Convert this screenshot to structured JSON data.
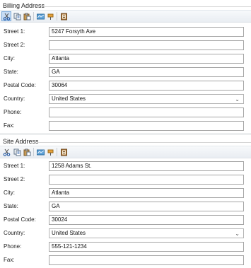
{
  "billing": {
    "title": "Billing Address",
    "fields": {
      "street1": {
        "label": "Street 1:",
        "value": "5247 Forsyth Ave"
      },
      "street2": {
        "label": "Street 2:",
        "value": ""
      },
      "city": {
        "label": "City:",
        "value": "Atlanta"
      },
      "state": {
        "label": "State:",
        "value": "GA"
      },
      "postal": {
        "label": "Postal Code:",
        "value": "30064"
      },
      "country": {
        "label": "Country:",
        "value": "United States"
      },
      "phone": {
        "label": "Phone:",
        "value": ""
      },
      "fax": {
        "label": "Fax:",
        "value": ""
      }
    }
  },
  "site": {
    "title": "Site Address",
    "fields": {
      "street1": {
        "label": "Street 1:",
        "value": "1258 Adams St."
      },
      "street2": {
        "label": "Street 2:",
        "value": ""
      },
      "city": {
        "label": "City:",
        "value": "Atlanta"
      },
      "state": {
        "label": "State:",
        "value": "GA"
      },
      "postal": {
        "label": "Postal Code:",
        "value": "30024"
      },
      "country": {
        "label": "Country:",
        "value": "United States"
      },
      "phone": {
        "label": "Phone:",
        "value": "555-121-1234"
      },
      "fax": {
        "label": "Fax:",
        "value": ""
      }
    }
  },
  "toolbar_icons": [
    "cut-icon",
    "copy-icon",
    "paste-icon",
    "map-icon",
    "pushpin-icon",
    "address-book-icon"
  ],
  "colors": {
    "active_button_bg": "#c7dcf4",
    "active_button_border": "#7aa8d8",
    "field_border": "#a5a5a5"
  }
}
